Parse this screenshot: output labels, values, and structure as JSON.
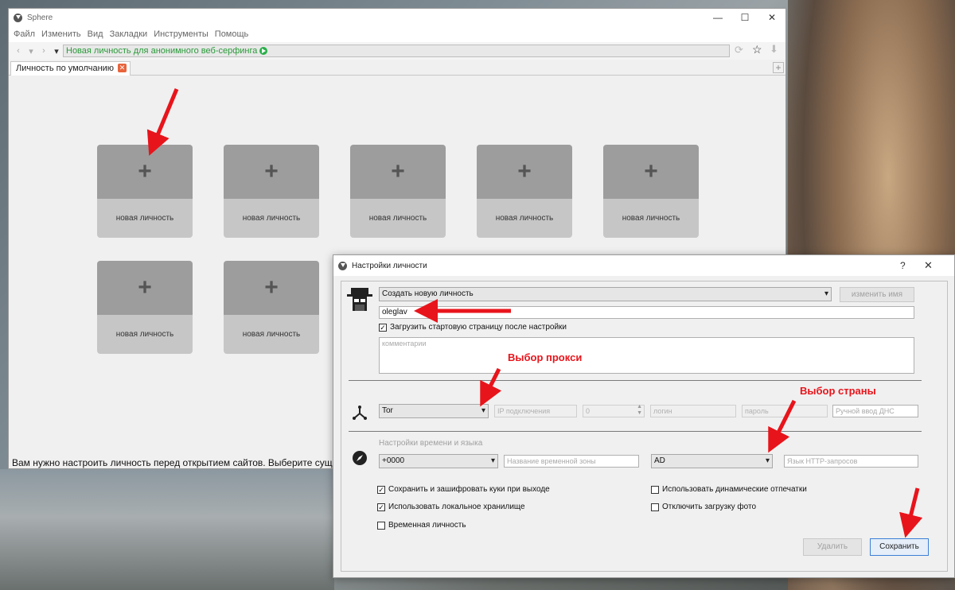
{
  "main_window": {
    "title": "Sphere",
    "menu": [
      "Файл",
      "Изменить",
      "Вид",
      "Закладки",
      "Инструменты",
      "Помощь"
    ],
    "url": "Новая личность для анонимного веб-серфинга",
    "tab_label": "Личность по умолчанию",
    "new_tab": "+",
    "cards": [
      {
        "plus": "+",
        "label": "новая личность"
      },
      {
        "plus": "+",
        "label": "новая личность"
      },
      {
        "plus": "+",
        "label": "новая личность"
      },
      {
        "plus": "+",
        "label": "новая личность"
      },
      {
        "plus": "+",
        "label": "новая личность"
      },
      {
        "plus": "+",
        "label": "новая личность"
      },
      {
        "plus": "+",
        "label": "новая личность"
      }
    ],
    "status_message": "Вам нужно настроить личность перед открытием сайтов. Выберите существу"
  },
  "dialog": {
    "title": "Настройки личности",
    "help": "?",
    "close": "✕",
    "identity_combo": "Создать новую личность",
    "rename_button": "изменить имя",
    "name_value": "oleglav",
    "load_start_page": "Загрузить стартовую страницу после настройки",
    "comments_placeholder": "комментарии",
    "proxy_type": "Tor",
    "ip_placeholder": "IP подключения",
    "port_value": "0",
    "login_placeholder": "логин",
    "password_placeholder": "пароль",
    "dns_placeholder": "Ручной ввод ДНС",
    "time_lang_label": "Настройки времени и языка",
    "timezone_offset": "+0000",
    "timezone_name_placeholder": "Название временной зоны",
    "country": "AD",
    "http_lang_placeholder": "Язык HTTP-запросов",
    "checkboxes": [
      {
        "label": "Сохранить и зашифровать куки при выходе",
        "checked": true
      },
      {
        "label": "Использовать локальное хранилище",
        "checked": true
      },
      {
        "label": "Временная личность",
        "checked": false
      },
      {
        "label": "Использовать динамические отпечатки",
        "checked": false
      },
      {
        "label": "Отключить загрузку фото",
        "checked": false
      }
    ],
    "delete_button": "Удалить",
    "save_button": "Сохранить"
  },
  "annotations": {
    "proxy_choice": "Выбор прокси",
    "country_choice": "Выбор страны",
    "color": "#e8141b"
  }
}
